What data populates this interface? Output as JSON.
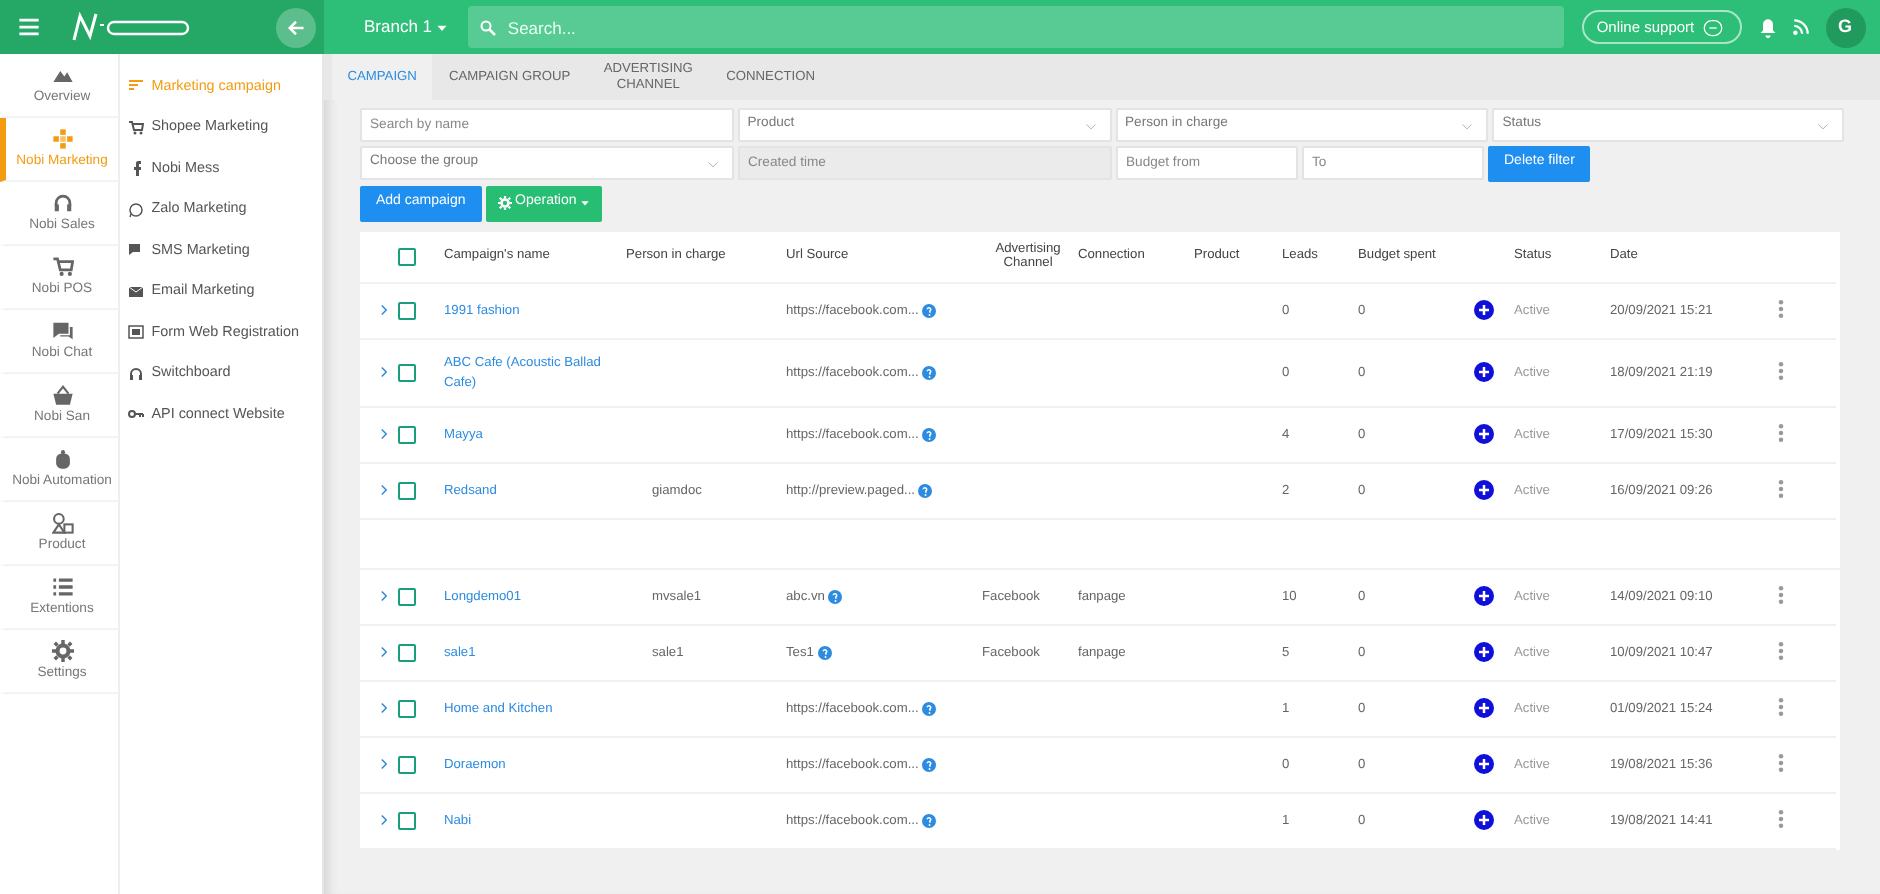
{
  "topbar": {
    "branch": "Branch 1",
    "search": {
      "placeholder": "Search..."
    },
    "online_support": "Online support",
    "avatar": "G"
  },
  "rail": [
    {
      "label": "Overview",
      "selected": false
    },
    {
      "label": "Nobi Marketing",
      "selected": true
    },
    {
      "label": "Nobi Sales",
      "selected": false
    },
    {
      "label": "Nobi POS",
      "selected": false
    },
    {
      "label": "Nobi Chat",
      "selected": false
    },
    {
      "label": "Nobi San",
      "selected": false
    },
    {
      "label": "Nobi Automation",
      "selected": false
    },
    {
      "label": "Product",
      "selected": false
    },
    {
      "label": "Extentions",
      "selected": false
    },
    {
      "label": "Settings",
      "selected": false
    }
  ],
  "submenu": [
    {
      "label": "Marketing campaign",
      "selected": true
    },
    {
      "label": "Shopee Marketing",
      "selected": false
    },
    {
      "label": "Nobi Mess",
      "selected": false
    },
    {
      "label": "Zalo Marketing",
      "selected": false
    },
    {
      "label": "SMS Marketing",
      "selected": false
    },
    {
      "label": "Email Marketing",
      "selected": false
    },
    {
      "label": "Form Web Registration",
      "selected": false
    },
    {
      "label": "Switchboard",
      "selected": false
    },
    {
      "label": "API connect Website",
      "selected": false
    }
  ],
  "tabs": [
    {
      "label": "CAMPAIGN",
      "selected": true
    },
    {
      "label": "CAMPAIGN GROUP",
      "selected": false
    },
    {
      "label": "ADVERTISING CHANNEL",
      "selected": false
    },
    {
      "label": "CONNECTION",
      "selected": false
    }
  ],
  "filters": [
    [
      {
        "kind": "input",
        "placeholder": "Search by name",
        "disabled": false
      },
      {
        "kind": "select",
        "placeholder": "Product"
      },
      {
        "kind": "select",
        "placeholder": "Person in charge"
      },
      {
        "kind": "select",
        "placeholder": "Status"
      }
    ],
    [
      {
        "kind": "select",
        "placeholder": "Choose the group"
      },
      {
        "kind": "input",
        "placeholder": "Created time",
        "disabled": true
      },
      {
        "kind": "input",
        "placeholder": "Budget from",
        "disabled": false
      },
      {
        "kind": "input",
        "placeholder": "To",
        "disabled": false
      },
      {
        "kind": "button",
        "label": "Delete filter"
      }
    ]
  ],
  "actions": {
    "add": "Add campaign",
    "operation": "Operation"
  },
  "table": {
    "all_checked": false,
    "columns": [
      "Campaign's name",
      "Person in charge",
      "Url Source",
      "Advertising Channel",
      "Connection",
      "Product",
      "Leads",
      "Budget spent",
      "Status",
      "Date"
    ],
    "rows": [
      {
        "checked": false,
        "name": "1991 fashion",
        "person": "",
        "url": "https://facebook.com...",
        "channel": "",
        "connection": "",
        "product": "",
        "leads": "0",
        "budget": "0",
        "status": "Active",
        "date": "20/09/2021 15:21"
      },
      {
        "checked": false,
        "name": "ABC Cafe (Acoustic Ballad Cafe)",
        "person": "",
        "url": "https://facebook.com...",
        "channel": "",
        "connection": "",
        "product": "",
        "leads": "0",
        "budget": "0",
        "status": "Active",
        "date": "18/09/2021 21:19"
      },
      {
        "checked": false,
        "name": "Mayya",
        "person": "",
        "url": "https://facebook.com...",
        "channel": "",
        "connection": "",
        "product": "",
        "leads": "4",
        "budget": "0",
        "status": "Active",
        "date": "17/09/2021 15:30"
      },
      {
        "checked": false,
        "name": "Redsand",
        "person": "giamdoc",
        "url": "http://preview.paged...",
        "channel": "",
        "connection": "",
        "product": "",
        "leads": "2",
        "budget": "0",
        "status": "Active",
        "date": "16/09/2021 09:26"
      },
      {
        "checked": false,
        "name": "Longdemo01",
        "person": "mvsale1",
        "url": "abc.vn",
        "channel": "Facebook",
        "connection": "fanpage",
        "product": "",
        "leads": "10",
        "budget": "0",
        "status": "Active",
        "date": "14/09/2021 09:10"
      },
      {
        "checked": false,
        "name": "sale1",
        "person": "sale1",
        "url": "Tes1",
        "channel": "Facebook",
        "connection": "fanpage",
        "product": "",
        "leads": "5",
        "budget": "0",
        "status": "Active",
        "date": "10/09/2021 10:47"
      },
      {
        "checked": false,
        "name": "Home and Kitchen",
        "person": "",
        "url": "https://facebook.com...",
        "channel": "",
        "connection": "",
        "product": "",
        "leads": "1",
        "budget": "0",
        "status": "Active",
        "date": "01/09/2021 15:24"
      },
      {
        "checked": false,
        "name": "Doraemon",
        "person": "",
        "url": "https://facebook.com...",
        "channel": "",
        "connection": "",
        "product": "",
        "leads": "0",
        "budget": "0",
        "status": "Active",
        "date": "19/08/2021 15:36"
      },
      {
        "checked": false,
        "name": "Nabi",
        "person": "",
        "url": "https://facebook.com...",
        "channel": "",
        "connection": "",
        "product": "",
        "leads": "1",
        "budget": "0",
        "status": "Active",
        "date": "19/08/2021 14:41"
      }
    ]
  }
}
